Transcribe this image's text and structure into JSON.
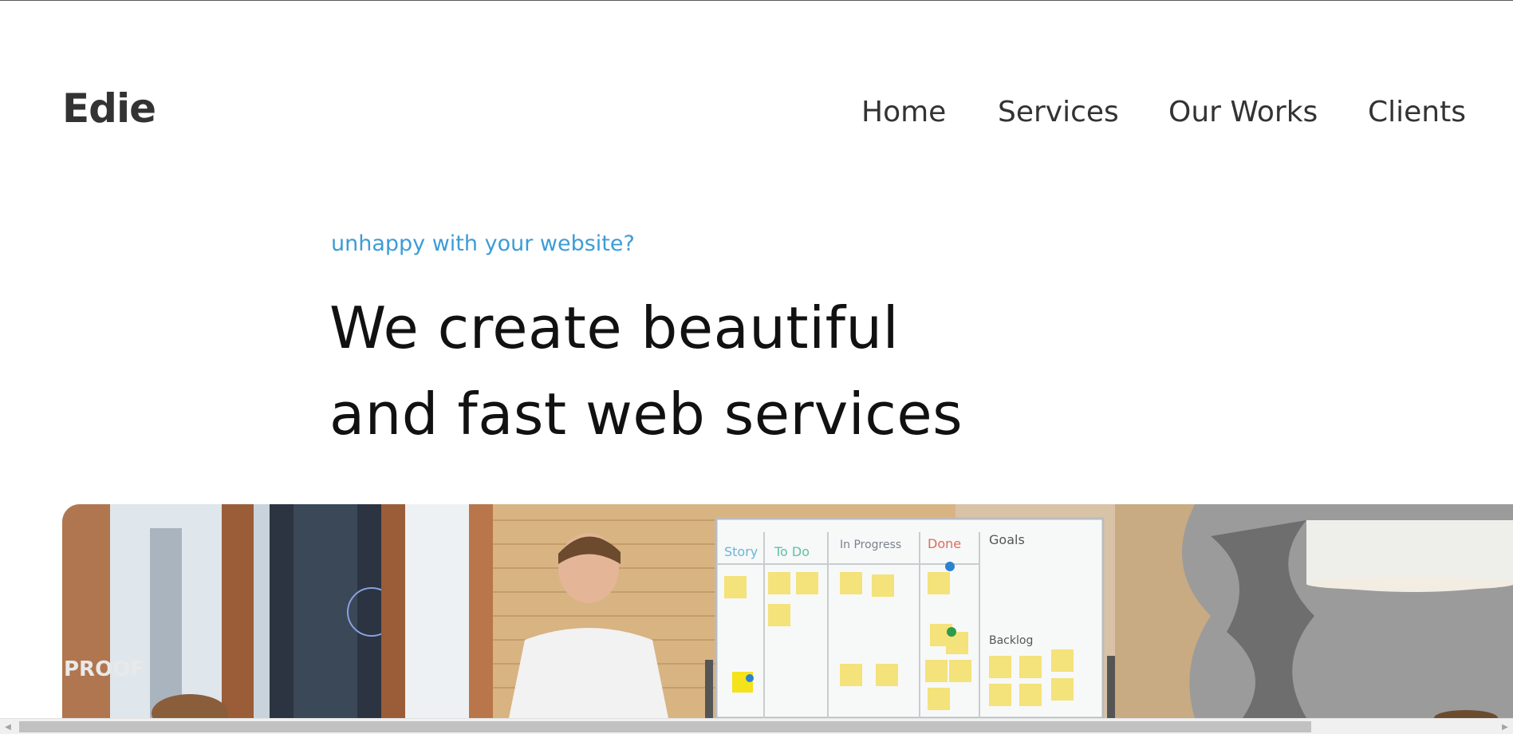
{
  "header": {
    "logo": "Edie",
    "nav": [
      {
        "label": "Home"
      },
      {
        "label": "Services"
      },
      {
        "label": "Our Works"
      },
      {
        "label": "Clients"
      }
    ]
  },
  "hero": {
    "eyebrow": "unhappy with your website?",
    "title_line1": "We create beautiful",
    "title_line2": "and fast web services"
  },
  "photo": {
    "board_headers": [
      "Story",
      "To Do",
      "In Progress",
      "Done",
      "Goals"
    ],
    "board_backlog": "Backlog",
    "wall_text": "PROOF"
  },
  "colors": {
    "accent": "#3d9cd6",
    "text": "#333333",
    "heading": "#111111"
  },
  "scrollbar": {
    "left_arrow_icon": "chevron-left-icon",
    "right_arrow_icon": "chevron-right-icon"
  }
}
